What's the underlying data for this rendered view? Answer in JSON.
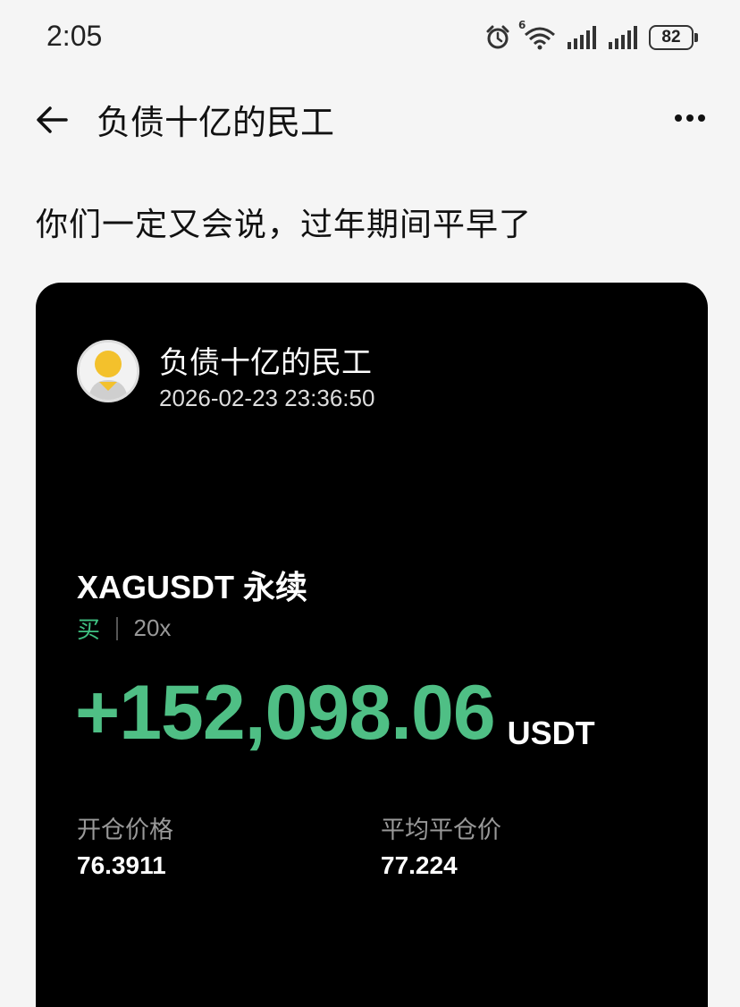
{
  "status_bar": {
    "time": "2:05",
    "battery": "82",
    "wifi_badge": "6"
  },
  "header": {
    "title": "负债十亿的民工",
    "back_icon": "arrow-left-icon",
    "more_icon": "more-horizontal-icon"
  },
  "post": {
    "text": "你们一定又会说，过年期间平早了"
  },
  "card": {
    "username": "负债十亿的民工",
    "datetime": "2026-02-23 23:36:50",
    "pair_symbol": "XAGUSDT",
    "pair_type": "永续",
    "side": "买",
    "leverage": "20x",
    "pnl": "+152,098.06",
    "pnl_unit": "USDT",
    "open_price_label": "开仓价格",
    "open_price": "76.3911",
    "avg_close_label": "平均平仓价",
    "avg_close": "77.224",
    "colors": {
      "profit_green": "#4fbf85",
      "buy_green": "#3fc182",
      "background": "#000000"
    }
  }
}
